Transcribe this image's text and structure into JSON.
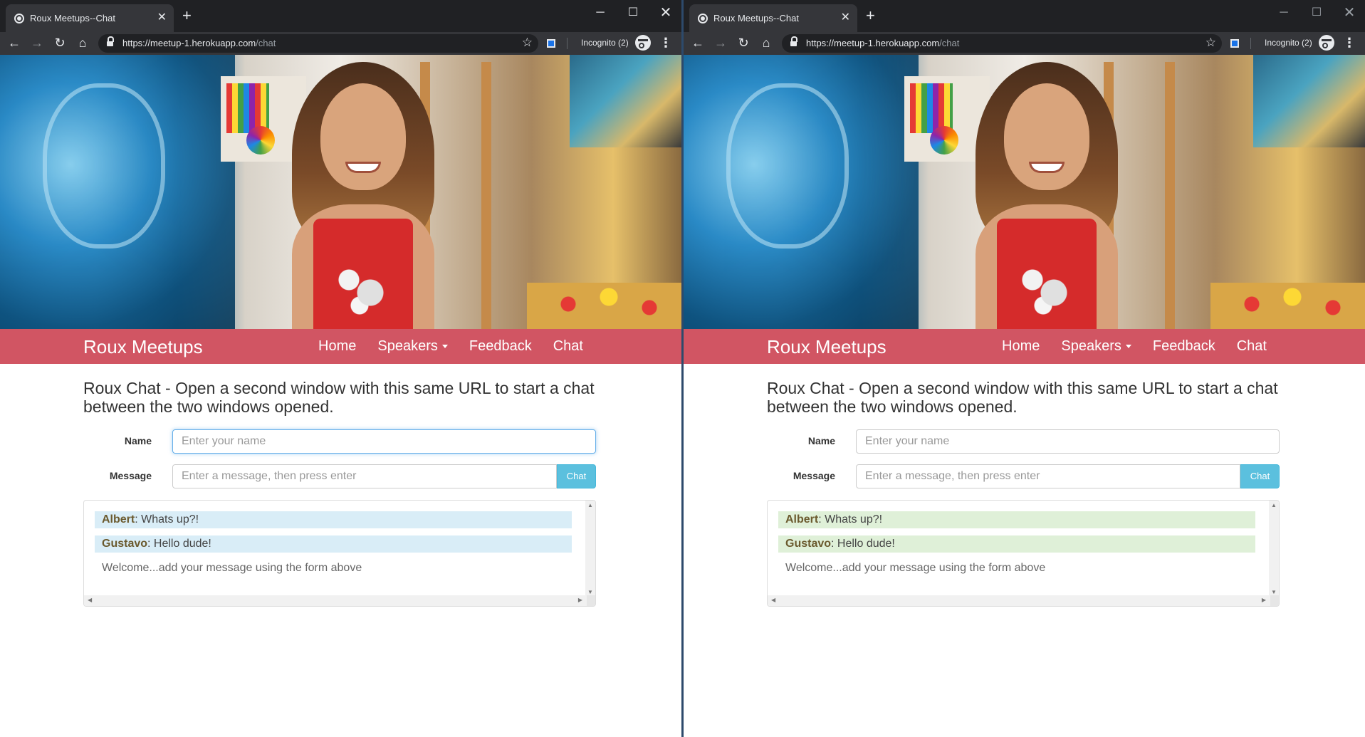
{
  "windows": [
    {
      "id": "left",
      "tab": {
        "title": "Roux Meetups--Chat",
        "close": "✕"
      },
      "new_tab": "+",
      "controls": {
        "minimize": "─",
        "maximize": "☐",
        "close": "✕"
      },
      "toolbar": {
        "back": "←",
        "forward": "→",
        "reload": "↻",
        "home": "⌂",
        "url_host": "https://meetup-1.herokuapp.com",
        "url_path": "/chat",
        "star": "☆",
        "incognito": "Incognito (2)",
        "menu": "⋮"
      },
      "navbar": {
        "brand": "Roux Meetups",
        "items": [
          "Home",
          "Speakers",
          "Feedback",
          "Chat"
        ]
      },
      "intro": "Roux Chat - Open a second window with this same URL to start a chat between the two windows opened.",
      "form": {
        "name_label": "Name",
        "name_placeholder": "Enter your name",
        "name_value": "",
        "message_label": "Message",
        "message_placeholder": "Enter a message, then press enter",
        "message_value": "",
        "chat_button": "Chat"
      },
      "messages": [
        {
          "sender": "Albert",
          "text": ": Whats up?!"
        },
        {
          "sender": "Gustavo",
          "text": ": Hello dude!"
        }
      ],
      "welcome": "Welcome...add your message using the form above",
      "message_bg": "#d9edf7",
      "name_focused": true
    },
    {
      "id": "right",
      "tab": {
        "title": "Roux Meetups--Chat",
        "close": "✕"
      },
      "new_tab": "+",
      "controls": {
        "minimize": "─",
        "maximize": "☐",
        "close": "✕"
      },
      "toolbar": {
        "back": "←",
        "forward": "→",
        "reload": "↻",
        "home": "⌂",
        "url_host": "https://meetup-1.herokuapp.com",
        "url_path": "/chat",
        "star": "☆",
        "incognito": "Incognito (2)",
        "menu": "⋮"
      },
      "navbar": {
        "brand": "Roux Meetups",
        "items": [
          "Home",
          "Speakers",
          "Feedback",
          "Chat"
        ]
      },
      "intro": "Roux Chat - Open a second window with this same URL to start a chat between the two windows opened.",
      "form": {
        "name_label": "Name",
        "name_placeholder": "Enter your name",
        "name_value": "",
        "message_label": "Message",
        "message_placeholder": "Enter a message, then press enter",
        "message_value": "",
        "chat_button": "Chat"
      },
      "messages": [
        {
          "sender": "Albert",
          "text": ": Whats up?!"
        },
        {
          "sender": "Gustavo",
          "text": ": Hello dude!"
        }
      ],
      "welcome": "Welcome...add your message using the form above",
      "message_bg": "#dff0d8",
      "name_focused": false
    }
  ],
  "colors": {
    "navbar": "#d15563",
    "chat_button": "#5bc0de",
    "divider": "#2d4a6b"
  }
}
